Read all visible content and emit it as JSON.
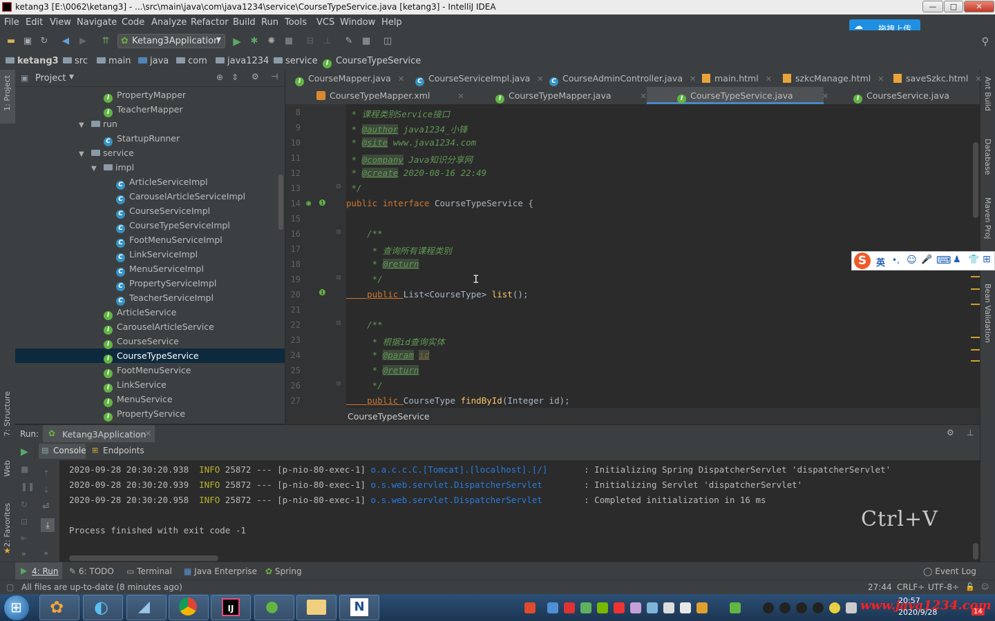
{
  "window": {
    "title": "ketang3 [E:\\0062\\ketang3] - ...\\src\\main\\java\\com\\java1234\\service\\CourseTypeService.java [ketang3] - IntelliJ IDEA",
    "btn_min": "—",
    "btn_max": "□",
    "btn_close": "✕"
  },
  "menu": [
    "File",
    "Edit",
    "View",
    "Navigate",
    "Code",
    "Analyze",
    "Refactor",
    "Build",
    "Run",
    "Tools",
    "VCS",
    "Window",
    "Help"
  ],
  "upload_button": "拖拽上传",
  "run_config": "Ketang3Application",
  "breadcrumbs": [
    "ketang3",
    "src",
    "main",
    "java",
    "com",
    "java1234",
    "service",
    "CourseTypeService"
  ],
  "project_panel": {
    "title": "Project",
    "items": [
      {
        "label": "PropertyMapper",
        "kind": "interface"
      },
      {
        "label": "TeacherMapper",
        "kind": "interface"
      },
      {
        "label": "run",
        "kind": "folder"
      },
      {
        "label": "StartupRunner",
        "kind": "class"
      },
      {
        "label": "service",
        "kind": "folder"
      },
      {
        "label": "impl",
        "kind": "folder"
      },
      {
        "label": "ArticleServiceImpl",
        "kind": "class"
      },
      {
        "label": "CarouselArticleServiceImpl",
        "kind": "class"
      },
      {
        "label": "CourseServiceImpl",
        "kind": "class"
      },
      {
        "label": "CourseTypeServiceImpl",
        "kind": "class"
      },
      {
        "label": "FootMenuServiceImpl",
        "kind": "class"
      },
      {
        "label": "LinkServiceImpl",
        "kind": "class"
      },
      {
        "label": "MenuServiceImpl",
        "kind": "class"
      },
      {
        "label": "PropertyServiceImpl",
        "kind": "class"
      },
      {
        "label": "TeacherServiceImpl",
        "kind": "class"
      },
      {
        "label": "ArticleService",
        "kind": "interface"
      },
      {
        "label": "CarouselArticleService",
        "kind": "interface"
      },
      {
        "label": "CourseService",
        "kind": "interface"
      },
      {
        "label": "CourseTypeService",
        "kind": "interface"
      },
      {
        "label": "FootMenuService",
        "kind": "interface"
      },
      {
        "label": "LinkService",
        "kind": "interface"
      },
      {
        "label": "MenuService",
        "kind": "interface"
      },
      {
        "label": "PropertyService",
        "kind": "interface"
      }
    ]
  },
  "tabs_row1": [
    "CourseMapper.java",
    "CourseServiceImpl.java",
    "CourseAdminController.java",
    "main.html",
    "szkcManage.html",
    "saveSzkc.html"
  ],
  "tabs_row2": [
    "CourseTypeMapper.xml",
    "CourseTypeMapper.java",
    "CourseTypeService.java",
    "CourseService.java"
  ],
  "editor": {
    "line_numbers": [
      "8",
      "9",
      "10",
      "11",
      "12",
      "13",
      "14",
      "15",
      "16",
      "17",
      "18",
      "19",
      "20",
      "21",
      "22",
      "23",
      "24",
      "25",
      "26",
      "27"
    ],
    "code": {
      "l8_star": " * ",
      "l8_text": "课程类别Service接口",
      "l9_star": " * ",
      "l9_tag": "@author",
      "l9_text": " java1234_小锋",
      "l10_star": " * ",
      "l10_tag": "@site",
      "l10_text": " www.java1234.com",
      "l11_star": " * ",
      "l11_tag": "@company",
      "l11_text": " Java知识分享网",
      "l12_star": " * ",
      "l12_tag": "@create",
      "l12_text": " 2020-08-16 22:49",
      "l13": " */",
      "l14_kw1": "public ",
      "l14_kw2": "interface ",
      "l14_name": "CourseTypeService {",
      "l16": "    /**",
      "l17_star": "     * ",
      "l17_text": "查询所有课程类别",
      "l18_star": "     * ",
      "l18_tag": "@return",
      "l19": "     */",
      "l20_kw": "    public ",
      "l20_type": "List<CourseType> ",
      "l20_fn": "list",
      "l20_rest": "();",
      "l22": "    /**",
      "l23_star": "     * ",
      "l23_text": "根据id查询实体",
      "l24_star": "     * ",
      "l24_tag": "@param",
      "l24_sp": " ",
      "l24_param": "id",
      "l25_star": "     * ",
      "l25_tag": "@return",
      "l26": "     */",
      "l27_kw": "    public ",
      "l27_type": "CourseType ",
      "l27_fn": "findById",
      "l27_rest": "(Integer id);"
    },
    "breadcrumb_bottom": "CourseTypeService"
  },
  "ime_bar": {
    "logo": "S",
    "lang": "英",
    "punct": "•,",
    "emoji": "☺",
    "mic": "🎤",
    "keyboard": "⌨"
  },
  "run_panel": {
    "label": "Run:",
    "config": "Ketang3Application",
    "tabs": [
      "Console",
      "Endpoints"
    ],
    "lines": [
      {
        "ts": "2020-09-28 20:30:20.938",
        "level": "INFO",
        "pid": "25872",
        "sep": "---",
        "thread": "[p-nio-80-exec-1]",
        "logger": "o.a.c.c.C.[Tomcat].[localhost].[/]",
        "msg": ": Initializing Spring DispatcherServlet 'dispatcherServlet'"
      },
      {
        "ts": "2020-09-28 20:30:20.939",
        "level": "INFO",
        "pid": "25872",
        "sep": "---",
        "thread": "[p-nio-80-exec-1]",
        "logger": "o.s.web.servlet.DispatcherServlet",
        "msg": ": Initializing Servlet 'dispatcherServlet'"
      },
      {
        "ts": "2020-09-28 20:30:20.958",
        "level": "INFO",
        "pid": "25872",
        "sep": "---",
        "thread": "[p-nio-80-exec-1]",
        "logger": "o.s.web.servlet.DispatcherServlet",
        "msg": ": Completed initialization in 16 ms"
      }
    ],
    "exit_line": "Process finished with exit code -1",
    "overlay": "Ctrl+V"
  },
  "bottom_tools": {
    "run": "4: Run",
    "todo": "6: TODO",
    "terminal": "Terminal",
    "java_ee": "Java Enterprise",
    "spring": "Spring",
    "event_log": "Event Log"
  },
  "left_strip": {
    "project": "1: Project",
    "structure": "7: Structure",
    "web": "Web",
    "favorites": "2: Favorites"
  },
  "right_strip": {
    "ant": "Ant Build",
    "database": "Database",
    "maven": "Maven Proj",
    "bean": "Bean Validation"
  },
  "status": {
    "message": "All files are up-to-date (8 minutes ago)",
    "position": "27:44",
    "line_sep": "CRLF÷",
    "encoding": "UTF-8÷"
  },
  "taskbar": {
    "time": "20:57",
    "date": "2020/9/28",
    "watermark": "www.java1234.com",
    "badge": "14"
  },
  "colors": {
    "accent": "#4a88c7",
    "selection": "#0d293e",
    "comment": "#629755",
    "keyword": "#cc7832",
    "function": "#ffc66d",
    "info": "#bbb529",
    "logger": "#287bde"
  }
}
